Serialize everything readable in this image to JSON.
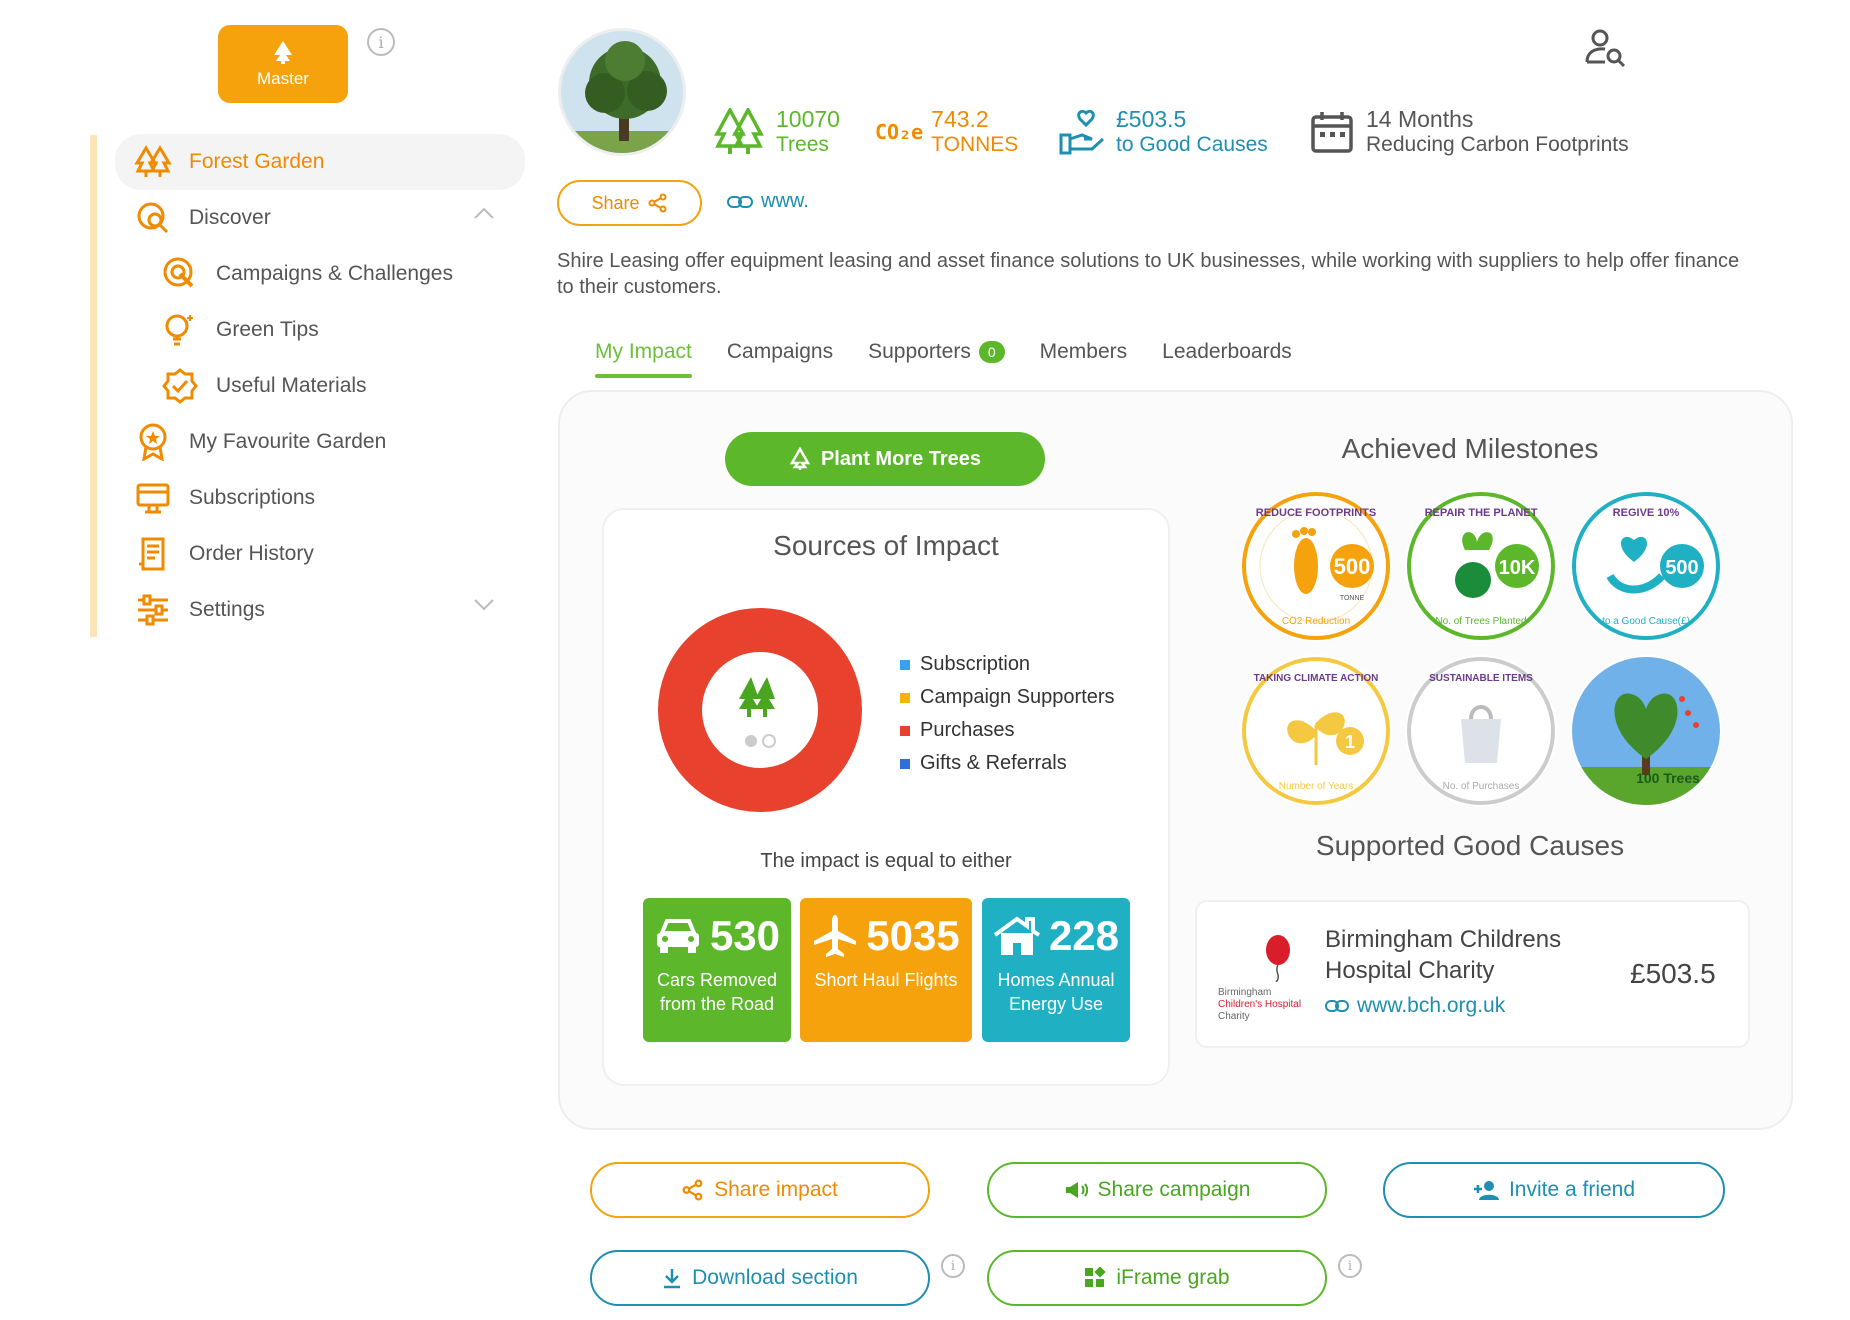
{
  "sidebar": {
    "master_label": "Master",
    "items": [
      {
        "label": "Forest Garden",
        "icon": "trees-icon"
      },
      {
        "label": "Discover",
        "icon": "discover-icon"
      },
      {
        "label": "Campaigns & Challenges",
        "icon": "campaign-icon"
      },
      {
        "label": "Green Tips",
        "icon": "lightbulb-icon"
      },
      {
        "label": "Useful Materials",
        "icon": "badge-check-icon"
      },
      {
        "label": "My Favourite Garden",
        "icon": "award-icon"
      },
      {
        "label": "Subscriptions",
        "icon": "subscriptions-icon"
      },
      {
        "label": "Order History",
        "icon": "receipt-icon"
      },
      {
        "label": "Settings",
        "icon": "sliders-icon"
      }
    ]
  },
  "header": {
    "stats": [
      {
        "value": "10070",
        "label": "Trees"
      },
      {
        "value": "743.2",
        "label": "TONNES",
        "prefix": "CO₂e"
      },
      {
        "value": "£503.5",
        "label": "to Good Causes"
      },
      {
        "value": "14 Months",
        "label": "Reducing Carbon Footprints"
      }
    ],
    "share_label": "Share",
    "website_label": "www.",
    "description": "Shire Leasing offer equipment leasing and asset finance solutions to UK businesses, while working with suppliers to help offer finance to their customers."
  },
  "tabs": [
    {
      "label": "My Impact",
      "active": true
    },
    {
      "label": "Campaigns"
    },
    {
      "label": "Supporters",
      "badge": "0"
    },
    {
      "label": "Members"
    },
    {
      "label": "Leaderboards"
    }
  ],
  "impact": {
    "plant_button": "Plant More Trees",
    "sources_title": "Sources of Impact",
    "legend": [
      {
        "label": "Subscription",
        "color": "#3aa0e8"
      },
      {
        "label": "Campaign Supporters",
        "color": "#f5b400"
      },
      {
        "label": "Purchases",
        "color": "#e8412e"
      },
      {
        "label": "Gifts & Referrals",
        "color": "#2f6fd8"
      }
    ],
    "equal_text": "The impact is equal to either",
    "tiles": [
      {
        "value": "530",
        "caption1": "Cars Removed",
        "caption2": "from the Road",
        "color": "#5cb82a"
      },
      {
        "value": "5035",
        "caption1": "Short Haul Flights",
        "caption2": "",
        "color": "#f5a20d"
      },
      {
        "value": "228",
        "caption1": "Homes Annual",
        "caption2": "Energy Use",
        "color": "#1fb0c4"
      }
    ]
  },
  "milestones": {
    "title": "Achieved Milestones",
    "items": [
      {
        "top": "REDUCE FOOTPRINTS",
        "value": "500",
        "sub": "TONNE",
        "bottom": "CO2 Reduction",
        "color": "#f5a20d"
      },
      {
        "top": "REPAIR THE PLANET",
        "value": "10K",
        "bottom": "No. of Trees Planted",
        "color": "#5cb82a"
      },
      {
        "top": "REGIVE 10%",
        "value": "500",
        "bottom": "to a Good Cause(£)",
        "color": "#1fb0c4"
      },
      {
        "top": "TAKING CLIMATE ACTION",
        "value": "1",
        "bottom": "Number of Years",
        "color": "#f5c842"
      },
      {
        "top": "SUSTAINABLE ITEMS",
        "value": "",
        "bottom": "No. of Purchases",
        "color": "#bbbbbb"
      },
      {
        "top": "",
        "value": "100 Trees",
        "bottom": "",
        "color": "#5cb82a"
      }
    ]
  },
  "good_causes": {
    "title": "Supported Good Causes",
    "name_line1": "Birmingham Childrens",
    "name_line2": "Hospital Charity",
    "url": "www.bch.org.uk",
    "amount": "£503.5",
    "logo_text1": "Birmingham",
    "logo_text2": "Children's Hospital",
    "logo_text3": "Charity"
  },
  "actions": {
    "share_impact": "Share impact",
    "share_campaign": "Share campaign",
    "invite_friend": "Invite a friend",
    "download_section": "Download section",
    "iframe_grab": "iFrame grab"
  }
}
